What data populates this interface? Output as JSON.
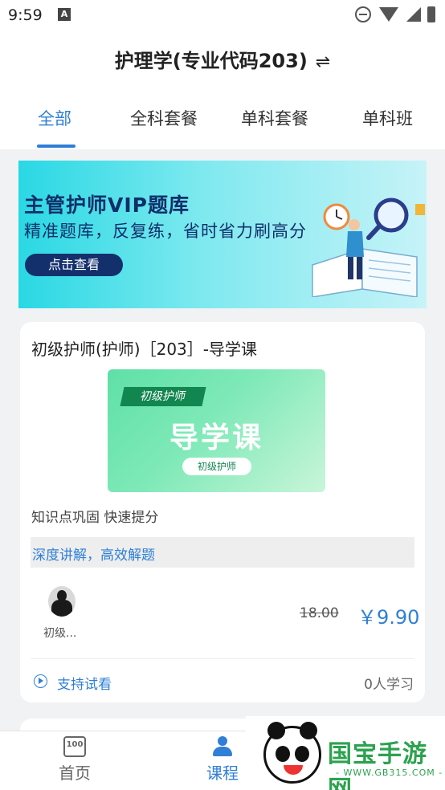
{
  "status_bar": {
    "time": "9:59"
  },
  "header": {
    "title": "护理学(专业代码203)",
    "switch_symbol": "⇌",
    "tabs": [
      {
        "label": "全部",
        "active": true
      },
      {
        "label": "全科套餐",
        "active": false
      },
      {
        "label": "单科套餐",
        "active": false
      },
      {
        "label": "单科班",
        "active": false
      }
    ]
  },
  "banner": {
    "title": "主管护师VIP题库",
    "subtitle": "精准题库，反复练，省时省力刷高分",
    "button_label": "点击查看"
  },
  "course": {
    "title": "初级护师(护师)［203］-导学课",
    "thumbnail": {
      "tag": "初级护师",
      "main_text": "导学课",
      "pill": "初级护师"
    },
    "description": "知识点巩固 快速提分",
    "highlight": "深度讲解，高效解题",
    "teacher_name": "初级...",
    "original_price": "18.00",
    "price": "￥9.90",
    "trial_label": "支持试看",
    "learner_count": "0人学习"
  },
  "bottom_nav": {
    "items": [
      {
        "label": "首页",
        "icon": "home-icon",
        "active": false
      },
      {
        "label": "课程",
        "icon": "course-icon",
        "active": true
      }
    ]
  },
  "watermark": {
    "text": "国宝手游网",
    "url": "- WWW.GB315.COM -"
  },
  "colors": {
    "accent": "#2f7fd6",
    "banner_navy": "#13306d",
    "thumb_green": "#5ee0a6",
    "watermark_green": "#2ca24f"
  }
}
